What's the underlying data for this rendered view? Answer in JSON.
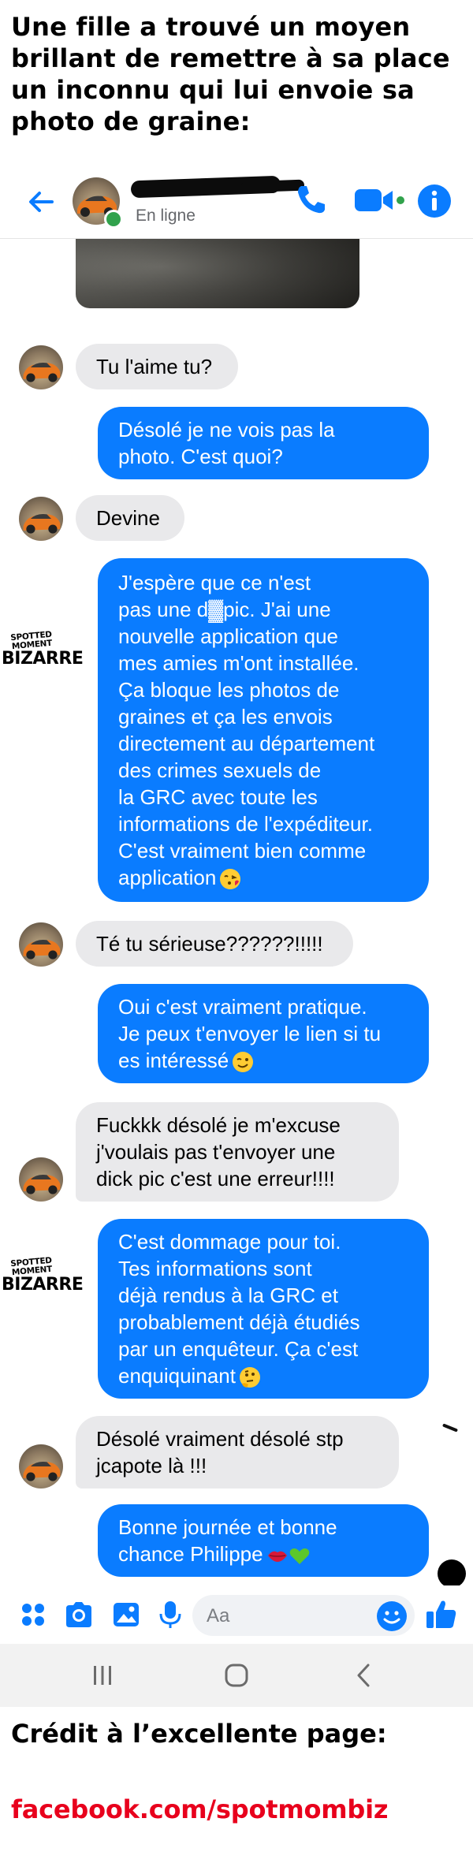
{
  "meme_title": "Une fille a trouvé un moyen brillant de remettre à sa place un inconnu qui lui envoie sa photo de graine:",
  "header": {
    "status": "En ligne"
  },
  "icons": {
    "back": "arrow-left-icon",
    "call": "phone-icon",
    "video": "video-camera-icon",
    "info": "info-icon",
    "apps": "four-dots-icon",
    "camera": "camera-icon",
    "gallery": "image-icon",
    "mic": "microphone-icon",
    "emoji": "smiley-icon",
    "like": "thumbs-up-icon"
  },
  "colors": {
    "accent": "#0a7cff",
    "incoming_bubble": "#e9e9eb",
    "online": "#31a24c",
    "credit_url": "#e8001c"
  },
  "messages": [
    {
      "from": "them",
      "lines": [
        "Tu l'aime tu?"
      ]
    },
    {
      "from": "me",
      "lines": [
        "Désolé je ne vois pas la",
        "photo. C'est quoi?"
      ]
    },
    {
      "from": "them",
      "lines": [
        "Devine"
      ]
    },
    {
      "from": "me",
      "lines": [
        "J'espère que ce n'est",
        "pas une d▓pic. J'ai une",
        "nouvelle application que",
        "mes amies m'ont installée.",
        "Ça bloque les photos de",
        "graines et ça les envois",
        "directement au département",
        "des crimes sexuels de",
        "la GRC avec toute les",
        "informations de l'expéditeur.",
        "C'est vraiment bien comme",
        "application"
      ],
      "emoji": "kiss-face-emoji"
    },
    {
      "from": "them",
      "lines": [
        "Té tu sérieuse??????!!!!!"
      ]
    },
    {
      "from": "me",
      "lines": [
        "Oui c'est vraiment pratique.",
        "Je peux t'envoyer le lien si tu",
        "es intéressé"
      ],
      "emoji": "wink-face-emoji"
    },
    {
      "from": "them",
      "lines": [
        "Fuckkk désolé je m'excuse",
        "j'voulais pas t'envoyer une",
        "dick pic c'est une erreur!!!!"
      ]
    },
    {
      "from": "me",
      "lines": [
        "C'est dommage pour toi.",
        "Tes informations sont",
        "déjà rendus à la GRC et",
        "probablement déjà étudiés",
        "par un enquêteur. Ça c'est",
        "enquiquinant"
      ],
      "emoji": "thinking-face-emoji"
    },
    {
      "from": "them",
      "lines": [
        "Désolé vraiment désolé stp",
        "jcapote là !!!"
      ]
    },
    {
      "from": "me",
      "lines": [
        "Bonne journée et bonne",
        "chance Philippe"
      ],
      "emoji": "lips-and-green-heart-emoji"
    }
  ],
  "watermark": {
    "top": "SPOTTED MOMENT",
    "bottom": "BIZARRE"
  },
  "composer": {
    "placeholder": "Aa"
  },
  "credit": {
    "line": "Crédit à l’excellente page:",
    "url": "facebook.com/spotmombiz"
  }
}
